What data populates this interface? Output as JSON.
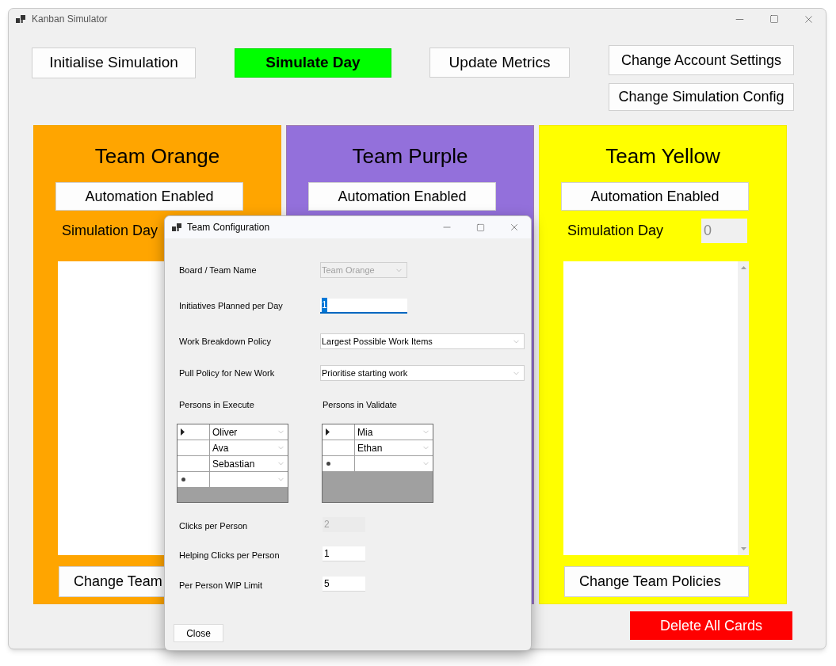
{
  "window": {
    "title": "Kanban Simulator"
  },
  "toolbar": [
    {
      "label": "Initialise Simulation",
      "kind": "plain"
    },
    {
      "label": "Simulate Day",
      "kind": "highlight"
    },
    {
      "label": "Update Metrics",
      "kind": "plain"
    }
  ],
  "account_buttons": [
    "Change Account Settings",
    "Change Simulation Config"
  ],
  "teams": [
    {
      "name": "Team Orange",
      "color": "#ffa500",
      "automation_button": "Automation Enabled",
      "simulation_day_label": "Simulation Day",
      "policies_button": "Change Team"
    },
    {
      "name": "Team Purple",
      "color": "#9370db",
      "automation_button": "Automation Enabled"
    },
    {
      "name": "Team Yellow",
      "color": "#ffff00",
      "automation_button": "Automation Enabled",
      "simulation_day_label": "Simulation Day",
      "simulation_day_value": "0",
      "policies_button": "Change Team Policies"
    }
  ],
  "delete_button": "Delete All Cards",
  "dialog": {
    "title": "Team Configuration",
    "fields_top": [
      {
        "label": "Board / Team Name",
        "kind": "combo",
        "value": "Team Orange",
        "disabled": true
      },
      {
        "label": "Initiatives Planned per Day",
        "kind": "text",
        "value": "1",
        "disabled": false,
        "focused": true
      },
      {
        "label": "Work Breakdown Policy",
        "kind": "combo",
        "value": "Largest Possible Work Items",
        "disabled": false
      },
      {
        "label": "Pull Policy for New Work",
        "kind": "combo",
        "value": "Prioritise starting work",
        "disabled": false
      }
    ],
    "grids": [
      {
        "label": "Persons in Execute",
        "rows": [
          {
            "name": "Oliver",
            "current": true
          },
          {
            "name": "Ava",
            "current": false
          },
          {
            "name": "Sebastian",
            "current": false
          }
        ]
      },
      {
        "label": "Persons in Validate",
        "rows": [
          {
            "name": "Mia",
            "current": true
          },
          {
            "name": "Ethan",
            "current": false
          }
        ]
      }
    ],
    "fields_bottom": [
      {
        "label": "Clicks per Person",
        "kind": "text",
        "value": "2",
        "disabled": true,
        "focused": false
      },
      {
        "label": "Helping Clicks per Person",
        "kind": "text",
        "value": "1",
        "disabled": false,
        "focused": false
      },
      {
        "label": "Per Person WIP Limit",
        "kind": "text",
        "value": "5",
        "disabled": false,
        "focused": false
      }
    ],
    "close_button": "Close"
  }
}
